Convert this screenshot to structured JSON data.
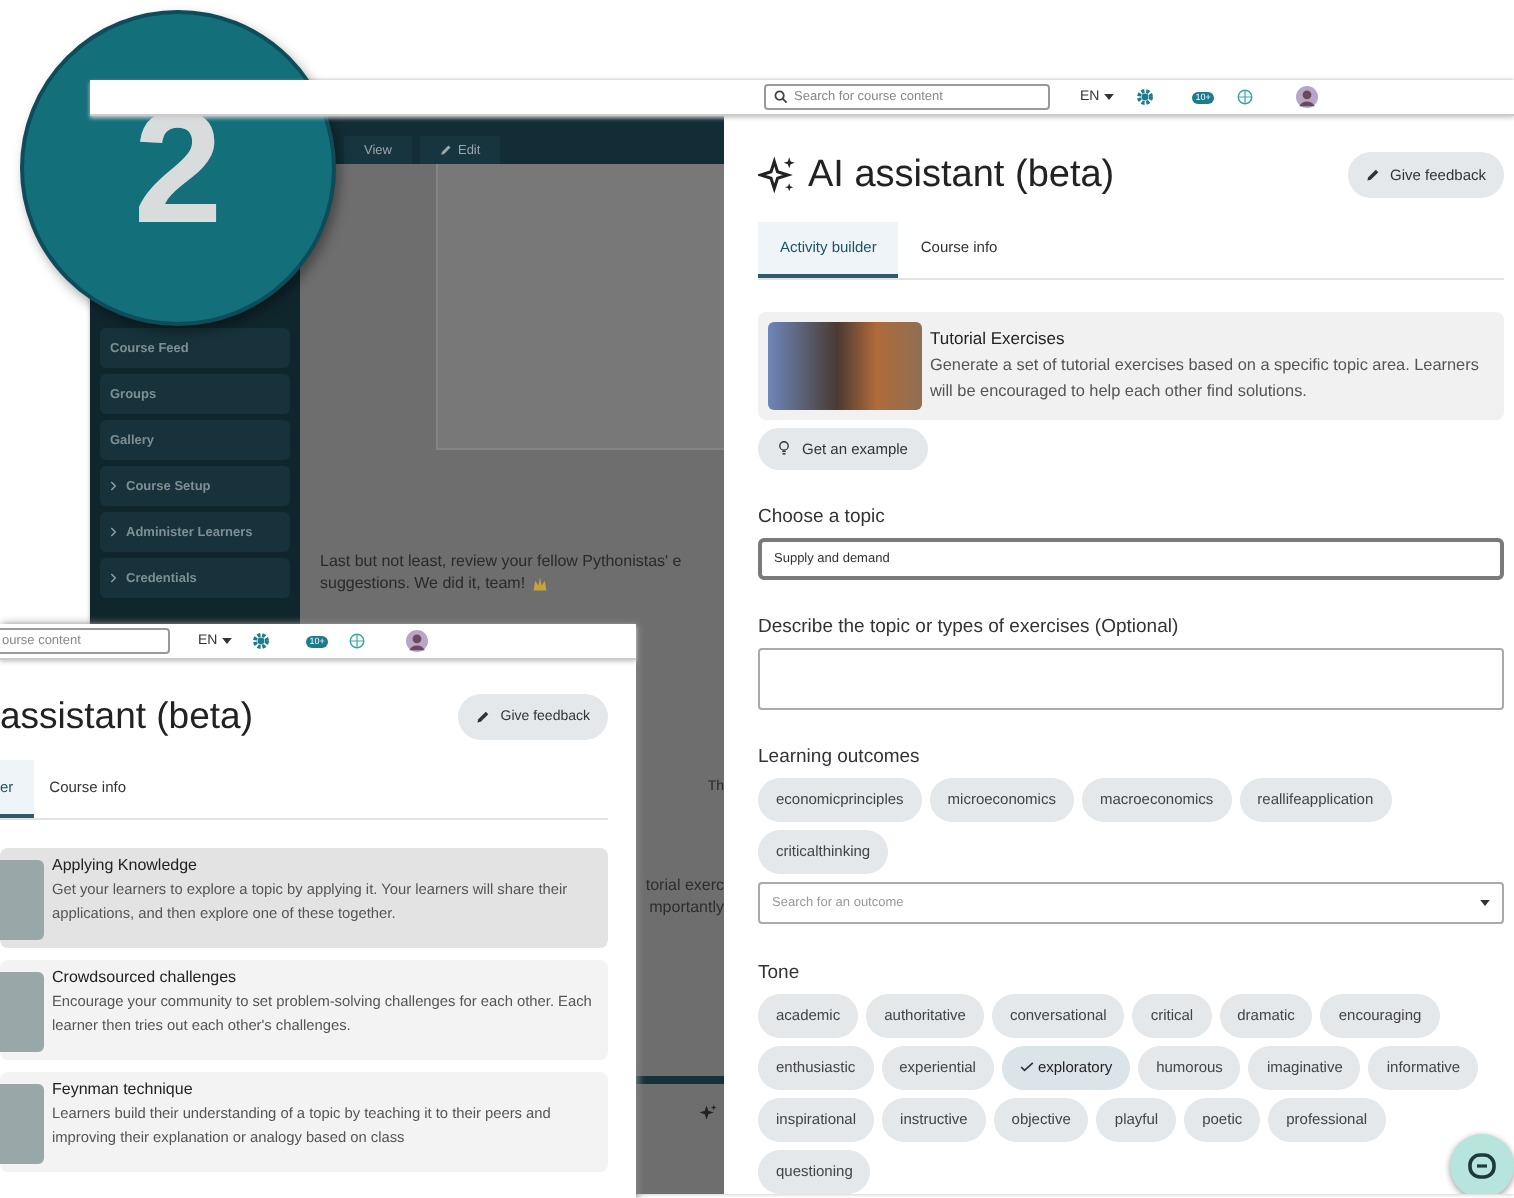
{
  "step_badge": "2",
  "back_window": {
    "header": {
      "search_placeholder": "Search for course content",
      "language": "EN",
      "notification_count": "10+"
    },
    "course_tabs": [
      {
        "label": "View",
        "kind": "view"
      },
      {
        "label": "Edit",
        "kind": "edit"
      }
    ],
    "sidebar": [
      {
        "label": "Course Feed",
        "kind": "link"
      },
      {
        "label": "Groups",
        "kind": "link"
      },
      {
        "label": "Gallery",
        "kind": "link"
      },
      {
        "label": "Course Setup",
        "kind": "group"
      },
      {
        "label": "Administer Learners",
        "kind": "group"
      },
      {
        "label": "Credentials",
        "kind": "group"
      }
    ],
    "content_lines": [
      "Last but not least, review your fellow Pythonistas' e",
      "suggestions. We did it, team!"
    ],
    "faint_text": "Th",
    "cut_lines": [
      "torial exerc",
      "mportantly"
    ]
  },
  "assistant": {
    "title": "AI assistant (beta)",
    "feedback_button": "Give feedback",
    "tabs": [
      {
        "label": "Activity builder",
        "selected": true
      },
      {
        "label": "Course info",
        "selected": false
      }
    ],
    "activity": {
      "title": "Tutorial Exercises",
      "description": "Generate a set of tutorial exercises based on a specific topic area. Learners will be encouraged to help each other find solutions."
    },
    "example_button": "Get an example",
    "topic": {
      "label": "Choose a topic",
      "value": "Supply and demand"
    },
    "describe": {
      "label": "Describe the topic or types of exercises (Optional)"
    },
    "outcomes": {
      "label": "Learning outcomes",
      "chips": [
        "economicprinciples",
        "microeconomics",
        "macroeconomics",
        "reallifeapplication",
        "criticalthinking"
      ],
      "placeholder": "Search for an outcome"
    },
    "tone": {
      "label": "Tone",
      "chips": [
        {
          "label": "academic",
          "selected": false
        },
        {
          "label": "authoritative",
          "selected": false
        },
        {
          "label": "conversational",
          "selected": false
        },
        {
          "label": "critical",
          "selected": false
        },
        {
          "label": "dramatic",
          "selected": false
        },
        {
          "label": "encouraging",
          "selected": false
        },
        {
          "label": "enthusiastic",
          "selected": false
        },
        {
          "label": "experiential",
          "selected": false
        },
        {
          "label": "exploratory",
          "selected": true
        },
        {
          "label": "humorous",
          "selected": false
        },
        {
          "label": "imaginative",
          "selected": false
        },
        {
          "label": "informative",
          "selected": false
        },
        {
          "label": "inspirational",
          "selected": false
        },
        {
          "label": "instructive",
          "selected": false
        },
        {
          "label": "objective",
          "selected": false
        },
        {
          "label": "playful",
          "selected": false
        },
        {
          "label": "poetic",
          "selected": false
        },
        {
          "label": "professional",
          "selected": false
        },
        {
          "label": "questioning",
          "selected": false
        }
      ]
    }
  },
  "front_window": {
    "header": {
      "search_text": "ourse content",
      "language": "EN",
      "notification_count": "10+"
    },
    "title": "assistant (beta)",
    "feedback_button": "Give feedback",
    "tabs": [
      {
        "label": "er",
        "selected": true
      },
      {
        "label": "Course info",
        "selected": false
      }
    ],
    "activities": [
      {
        "title": "Applying Knowledge",
        "description": "Get your learners to explore a topic by applying it. Your learners will share their applications, and then explore one of these together.",
        "selected": true
      },
      {
        "title": "Crowdsourced challenges",
        "description": "Encourage your community to set problem-solving challenges for each other. Each learner then tries out each other's challenges.",
        "selected": false
      },
      {
        "title": "Feynman technique",
        "description": "Learners build their understanding of a topic by teaching it to their peers and improving their explanation or analogy based on class",
        "selected": false
      }
    ]
  }
}
